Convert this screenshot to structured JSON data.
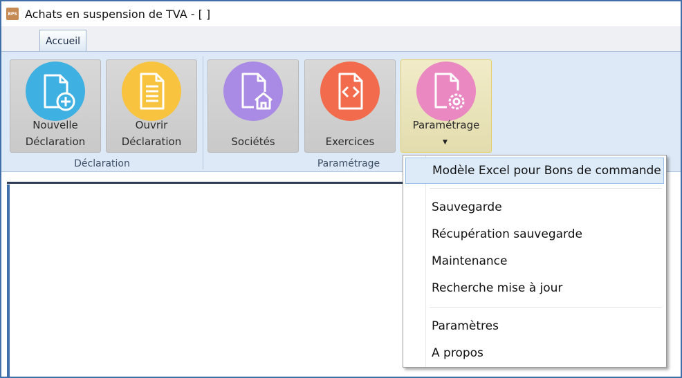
{
  "window": {
    "title": "Achats en suspension de TVA - [ ]",
    "logo_text": "BPS"
  },
  "tabs": [
    {
      "label": "Accueil",
      "active": true
    }
  ],
  "ribbon": {
    "groups": [
      {
        "label": "Déclaration"
      },
      {
        "label": "Paramétrage"
      }
    ],
    "buttons": {
      "nouvelle": {
        "line1": "Nouvelle",
        "line2": "Déclaration",
        "icon": "document-add-icon",
        "color": "#3fb0e2"
      },
      "ouvrir": {
        "line1": "Ouvrir",
        "line2": "Déclaration",
        "icon": "document-lines-icon",
        "color": "#f8c33e"
      },
      "societes": {
        "label": "Sociétés",
        "icon": "document-home-icon",
        "color": "#a98ae4"
      },
      "exercices": {
        "label": "Exercices",
        "icon": "code-file-icon",
        "color": "#f26b4c"
      },
      "parametrage": {
        "label": "Paramétrage",
        "icon": "document-gear-icon",
        "color": "#ea88c2"
      }
    }
  },
  "menu": {
    "items": [
      {
        "label": "Modèle Excel pour Bons de commande",
        "highlighted": true
      },
      {
        "label": "Sauvegarde"
      },
      {
        "label": "Récupération sauvegarde"
      },
      {
        "label": "Maintenance"
      },
      {
        "label": "Recherche mise à jour"
      },
      {
        "label": "Paramètres"
      },
      {
        "label": "A propos"
      }
    ]
  }
}
